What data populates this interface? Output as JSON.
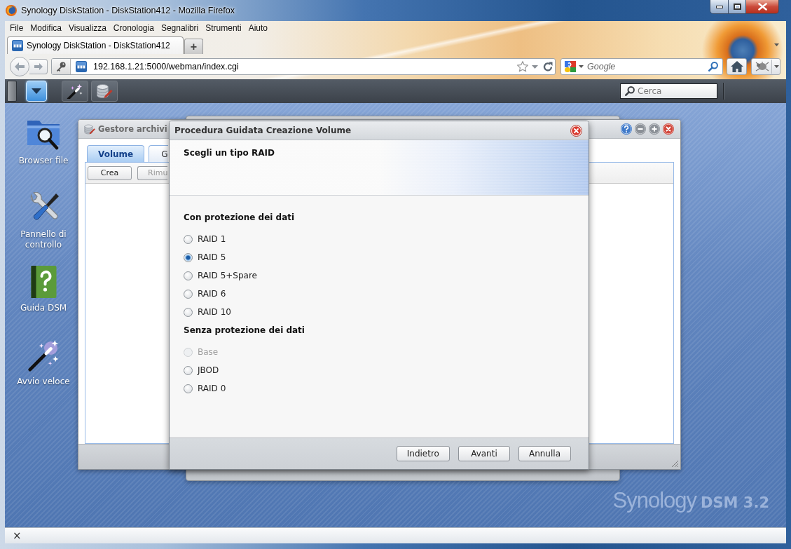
{
  "window": {
    "title": "Synology DiskStation - DiskStation412 - Mozilla Firefox"
  },
  "menu_bar": [
    "File",
    "Modifica",
    "Visualizza",
    "Cronologia",
    "Segnalibri",
    "Strumenti",
    "Aiuto"
  ],
  "tabs": [
    {
      "label": "Synology DiskStation - DiskStation412",
      "selected": true
    }
  ],
  "new_tab_button": "+",
  "address_bar": {
    "value": "192.168.1.21:5000/webman/index.cgi"
  },
  "search_bar": {
    "placeholder": "Google"
  },
  "dsm_taskbar": {
    "quick_launch": [
      {
        "kind": "wand"
      },
      {
        "kind": "storage"
      }
    ],
    "search": {
      "placeholder": "Cerca"
    }
  },
  "desktop_shortcuts": [
    {
      "label": "Browser file",
      "kind": "folder"
    },
    {
      "label": "Pannello di controllo",
      "kind": "tools"
    },
    {
      "label": "Guida DSM",
      "kind": "help"
    },
    {
      "label": "Avvio veloce",
      "kind": "wand"
    }
  ],
  "storage_manager": {
    "title": "Gestore archivi",
    "tabs": [
      {
        "label": "Volume",
        "selected": true
      },
      {
        "label": "G",
        "selected": false
      }
    ],
    "toolbar": [
      {
        "label": "Crea",
        "disabled": false
      },
      {
        "label": "Rimu",
        "disabled": true
      }
    ]
  },
  "dialog": {
    "title": "Procedura Guidata Creazione Volume",
    "heading": "Scegli un tipo RAID",
    "groups": [
      {
        "title": "Con protezione dei dati",
        "options": [
          {
            "label": "RAID 1",
            "selected": false,
            "disabled": false
          },
          {
            "label": "RAID 5",
            "selected": true,
            "disabled": false
          },
          {
            "label": "RAID 5+Spare",
            "selected": false,
            "disabled": false
          },
          {
            "label": "RAID 6",
            "selected": false,
            "disabled": false
          },
          {
            "label": "RAID 10",
            "selected": false,
            "disabled": false
          }
        ]
      },
      {
        "title": "Senza protezione dei dati",
        "options": [
          {
            "label": "Base",
            "selected": false,
            "disabled": true
          },
          {
            "label": "JBOD",
            "selected": false,
            "disabled": false
          },
          {
            "label": "RAID 0",
            "selected": false,
            "disabled": false
          }
        ]
      }
    ],
    "buttons": [
      "Indietro",
      "Avanti",
      "Annulla"
    ]
  },
  "branding": {
    "name": "Synology",
    "product": "DSM 3.2"
  },
  "status_bar": {
    "close_button": "×"
  }
}
